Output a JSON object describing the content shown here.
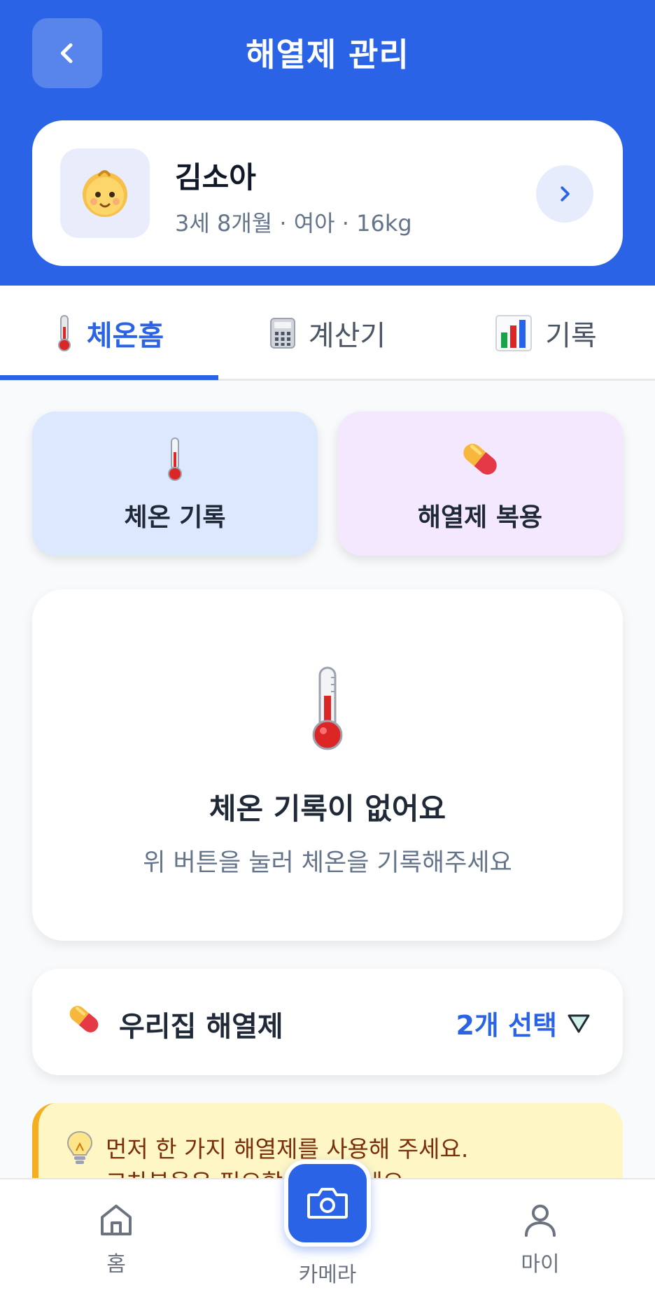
{
  "header": {
    "title": "해열제 관리"
  },
  "profile": {
    "name": "김소아",
    "info": "3세 8개월 · 여아 · 16kg",
    "avatar_icon": "baby-face-icon"
  },
  "tabs": [
    {
      "label": "체온홈",
      "icon": "thermometer-icon",
      "active": true
    },
    {
      "label": "계산기",
      "icon": "calculator-icon",
      "active": false
    },
    {
      "label": "기록",
      "icon": "bar-chart-icon",
      "active": false
    }
  ],
  "actions": {
    "temp_record": {
      "label": "체온 기록",
      "icon": "thermometer-icon"
    },
    "med_take": {
      "label": "해열제 복용",
      "icon": "pill-icon"
    }
  },
  "empty_state": {
    "title": "체온 기록이 없어요",
    "description": "위 버튼을 눌러 체온을 기록해주세요"
  },
  "medicine": {
    "title": "우리집 해열제",
    "selected_count": "2개 선택"
  },
  "tip": {
    "line1": "먼저 한 가지 해열제를 사용해 주세요.",
    "line2": "교차복용은 필요할 때만 하세요."
  },
  "bottom_nav": {
    "home": "홈",
    "camera": "카메라",
    "my": "마이"
  },
  "colors": {
    "primary": "#2a63e6",
    "temp_card": "#dbe8fd",
    "med_card": "#f3e8fd",
    "tip_bg": "#fef6c4",
    "tip_border": "#f4ae1e"
  }
}
